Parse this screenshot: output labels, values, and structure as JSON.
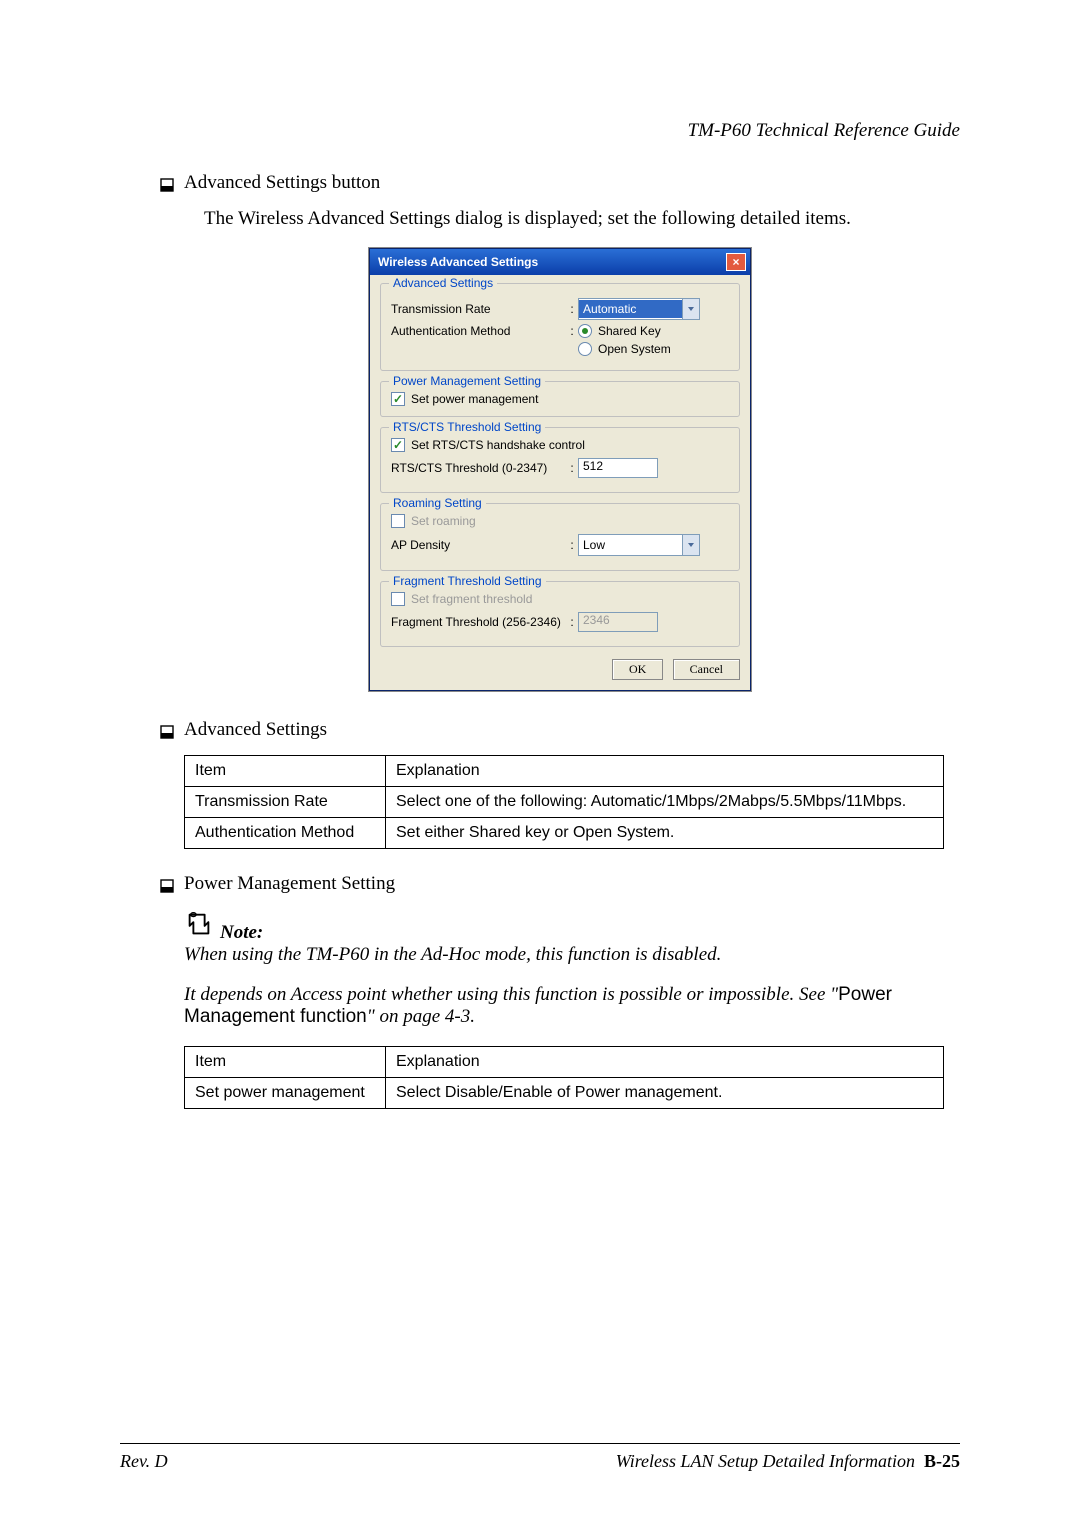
{
  "doc_title": "TM-P60 Technical Reference Guide",
  "section1": {
    "bullet": "Advanced Settings button",
    "desc": "The Wireless Advanced Settings dialog is displayed; set the following detailed items."
  },
  "dialog": {
    "title": "Wireless Advanced Settings",
    "groups": {
      "advanced": {
        "title": "Advanced Settings",
        "rate_label": "Transmission Rate",
        "rate_value": "Automatic",
        "auth_label": "Authentication Method",
        "auth_shared": "Shared Key",
        "auth_open": "Open System"
      },
      "power": {
        "title": "Power Management Setting",
        "checkbox": "Set power management"
      },
      "rts": {
        "title": "RTS/CTS Threshold Setting",
        "checkbox": "Set RTS/CTS handshake control",
        "thresh_label": "RTS/CTS Threshold (0-2347)",
        "thresh_value": "512"
      },
      "roaming": {
        "title": "Roaming Setting",
        "checkbox": "Set roaming",
        "density_label": "AP Density",
        "density_value": "Low"
      },
      "fragment": {
        "title": "Fragment Threshold Setting",
        "checkbox": "Set fragment threshold",
        "thresh_label": "Fragment Threshold (256-2346)",
        "thresh_value": "2346"
      }
    },
    "ok": "OK",
    "cancel": "Cancel"
  },
  "section2": {
    "bullet": "Advanced Settings",
    "head_item": "Item",
    "head_expl": "Explanation",
    "rows": [
      {
        "item": "Transmission Rate",
        "expl": "Select one of the following: Automatic/1Mbps/2Mabps/5.5Mbps/11Mbps."
      },
      {
        "item": "Authentication Method",
        "expl": "Set either Shared key or Open System."
      }
    ]
  },
  "section3": {
    "bullet": "Power Management Setting",
    "note_label": "Note:",
    "note1": "When using the TM-P60 in the Ad-Hoc mode, this function is disabled.",
    "note2_pre": "It depends on Access point whether using this function is possible or impossible.  See  \"",
    "note2_code": "Power Management function",
    "note2_post": "\" on page 4-3.",
    "head_item": "Item",
    "head_expl": "Explanation",
    "rows": [
      {
        "item": "Set power management",
        "expl": "Select Disable/Enable of Power management."
      }
    ]
  },
  "footer": {
    "rev": "Rev. D",
    "section": "Wireless LAN Setup Detailed Information",
    "page": "B-25"
  }
}
